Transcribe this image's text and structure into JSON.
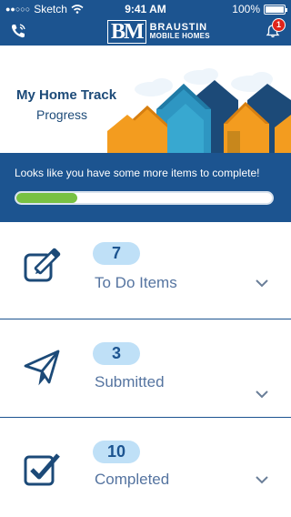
{
  "status_bar": {
    "carrier": "Sketch",
    "time": "9:41 AM",
    "battery": "100%"
  },
  "nav": {
    "logo_mark": "BM",
    "logo_line1": "BRAUSTIN",
    "logo_line2": "MOBILE HOMES",
    "notification_count": "1"
  },
  "hero": {
    "title": "My Home Track",
    "subtitle": "Progress"
  },
  "progress": {
    "message": "Looks like you have some more items to complete!",
    "fraction": 0.24
  },
  "items": [
    {
      "count": "7",
      "label": "To Do Items",
      "icon": "edit-icon"
    },
    {
      "count": "3",
      "label": "Submitted",
      "icon": "paper-plane-icon"
    },
    {
      "count": "10",
      "label": "Completed",
      "icon": "checkbox-icon"
    }
  ],
  "colors": {
    "primary": "#1c5490",
    "progress_fill": "#78c143",
    "badge_bg": "#bfe0f7",
    "notification": "#e0241b"
  }
}
